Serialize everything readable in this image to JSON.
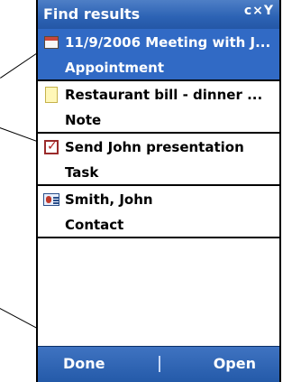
{
  "window": {
    "title": "Find results",
    "status": "c×Y"
  },
  "results": [
    {
      "title": "11/9/2006 Meeting with J...",
      "type": "Appointment",
      "icon": "calendar-icon"
    },
    {
      "title": "Restaurant bill - dinner ...",
      "type": "Note",
      "icon": "note-icon"
    },
    {
      "title": "Send John presentation",
      "type": "Task",
      "icon": "task-icon"
    },
    {
      "title": "Smith, John",
      "type": "Contact",
      "icon": "contact-icon"
    }
  ],
  "softkeys": {
    "left": "Done",
    "right": "Open"
  },
  "colors": {
    "selected": "#316ac5",
    "bar": "#2c62b4"
  }
}
